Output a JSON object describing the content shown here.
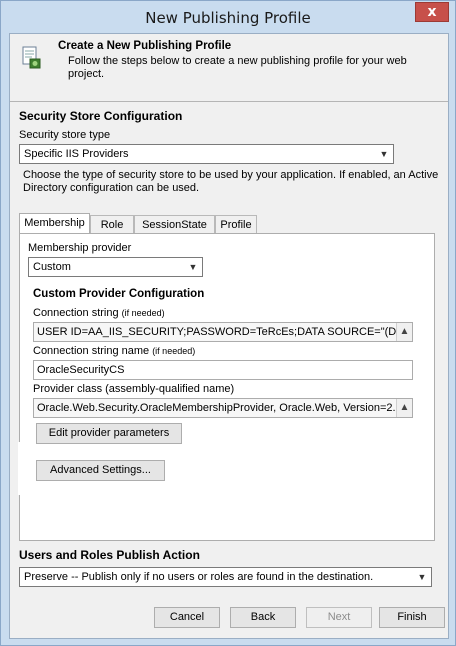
{
  "window": {
    "title": "New Publishing Profile",
    "close_glyph": "x"
  },
  "header": {
    "title": "Create a New Publishing Profile",
    "description": "Follow the steps below to create a new publishing profile for your web project."
  },
  "security": {
    "section_title": "Security Store Configuration",
    "store_type_label": "Security store type",
    "store_type_value": "Specific IIS Providers",
    "description": "Choose the type of security store to be used by your application. If enabled, an Active Directory configuration can be used."
  },
  "tabs": [
    {
      "label": "Membership",
      "active": true
    },
    {
      "label": "Role",
      "active": false
    },
    {
      "label": "SessionState",
      "active": false
    },
    {
      "label": "Profile",
      "active": false
    }
  ],
  "membership": {
    "provider_label": "Membership provider",
    "provider_value": "Custom",
    "custom_title": "Custom Provider Configuration",
    "conn_label": "Connection string",
    "conn_hint": "(if needed)",
    "conn_value": "USER ID=AA_IIS_SECURITY;PASSWORD=TeRcEs;DATA SOURCE=\"(DESC",
    "conn_name_label": "Connection string name",
    "conn_name_hint": "(if needed)",
    "conn_name_value": "OracleSecurityCS",
    "provider_class_label": "Provider class (assembly-qualified name)",
    "provider_class_value": "Oracle.Web.Security.OracleMembershipProvider, Oracle.Web, Version=2.",
    "edit_params_label": "Edit provider parameters",
    "advanced_label": "Advanced Settings..."
  },
  "publish": {
    "section_title": "Users and Roles Publish Action",
    "action_value": "Preserve -- Publish only if no users or roles are found in the destination."
  },
  "buttons": {
    "cancel": "Cancel",
    "back": "Back",
    "next": "Next",
    "finish": "Finish"
  },
  "icons": {
    "dropdown": "chevron-down-icon",
    "scroll": "chevron-up-icon",
    "header": "publish-profile-icon"
  },
  "colors": {
    "frame": "#c9dcef",
    "dialog_bg": "#f0f0f0",
    "close": "#c7504a",
    "disabled_text": "#8c8c8c"
  }
}
